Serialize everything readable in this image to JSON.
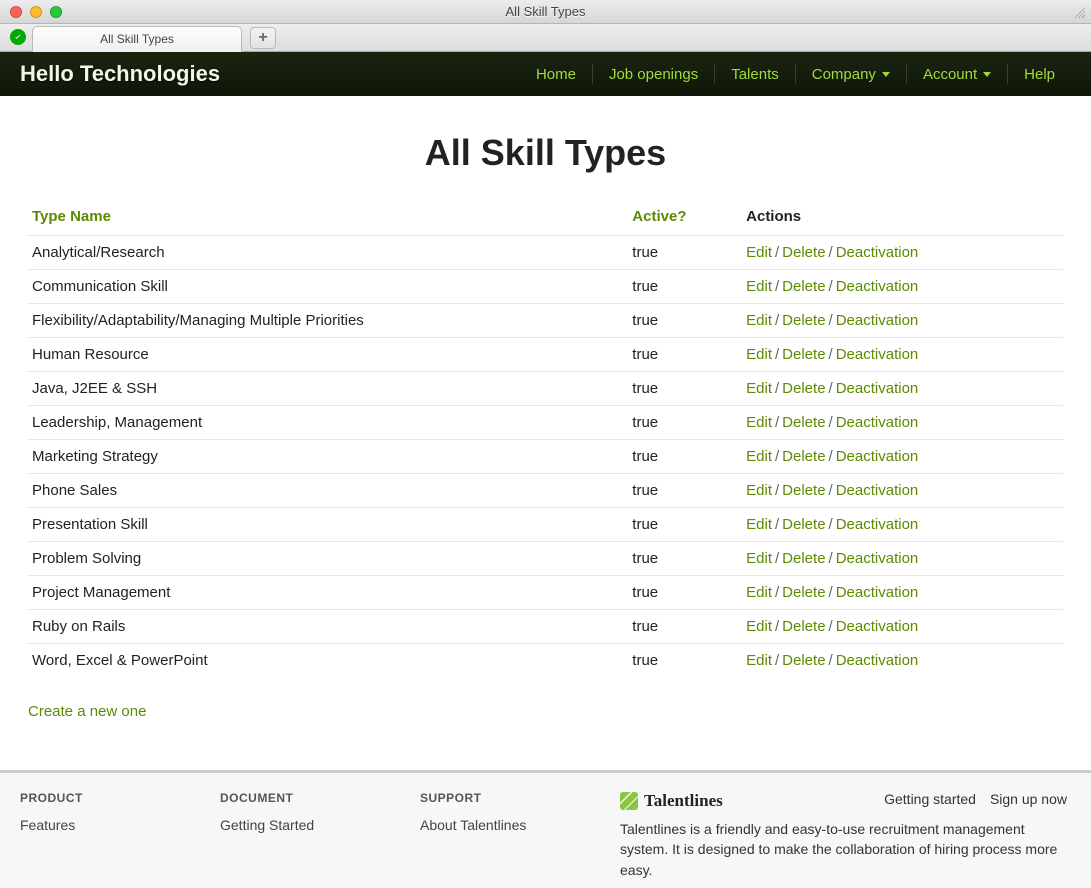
{
  "window": {
    "title": "All Skill Types"
  },
  "tab": {
    "title": "All Skill Types"
  },
  "brand": "Hello Technologies",
  "nav": {
    "home": "Home",
    "jobs": "Job openings",
    "talents": "Talents",
    "company": "Company",
    "account": "Account",
    "help": "Help"
  },
  "page": {
    "title": "All Skill Types",
    "headers": {
      "name": "Type Name",
      "active": "Active?",
      "actions": "Actions"
    },
    "actions": {
      "edit": "Edit",
      "delete": "Delete",
      "deactivate": "Deactivation"
    },
    "rows": [
      {
        "name": "Analytical/Research",
        "active": "true"
      },
      {
        "name": "Communication Skill",
        "active": "true"
      },
      {
        "name": "Flexibility/Adaptability/Managing Multiple Priorities",
        "active": "true"
      },
      {
        "name": "Human Resource",
        "active": "true"
      },
      {
        "name": "Java, J2EE & SSH",
        "active": "true"
      },
      {
        "name": "Leadership, Management",
        "active": "true"
      },
      {
        "name": "Marketing Strategy",
        "active": "true"
      },
      {
        "name": "Phone Sales",
        "active": "true"
      },
      {
        "name": "Presentation Skill",
        "active": "true"
      },
      {
        "name": "Problem Solving",
        "active": "true"
      },
      {
        "name": "Project Management",
        "active": "true"
      },
      {
        "name": "Ruby on Rails",
        "active": "true"
      },
      {
        "name": "Word, Excel & PowerPoint",
        "active": "true"
      }
    ],
    "create": "Create a new one"
  },
  "footer": {
    "cols": {
      "product": {
        "title": "PRODUCT",
        "links": [
          "Features"
        ]
      },
      "document": {
        "title": "DOCUMENT",
        "links": [
          "Getting Started"
        ]
      },
      "support": {
        "title": "SUPPORT",
        "links": [
          "About Talentlines"
        ]
      }
    },
    "logo": "Talentlines",
    "desc": "Talentlines is a friendly and easy-to-use recruitment management system. It is designed to make the collaboration of hiring process more easy.",
    "top_links": {
      "getting_started": "Getting started",
      "signup": "Sign up now"
    }
  }
}
